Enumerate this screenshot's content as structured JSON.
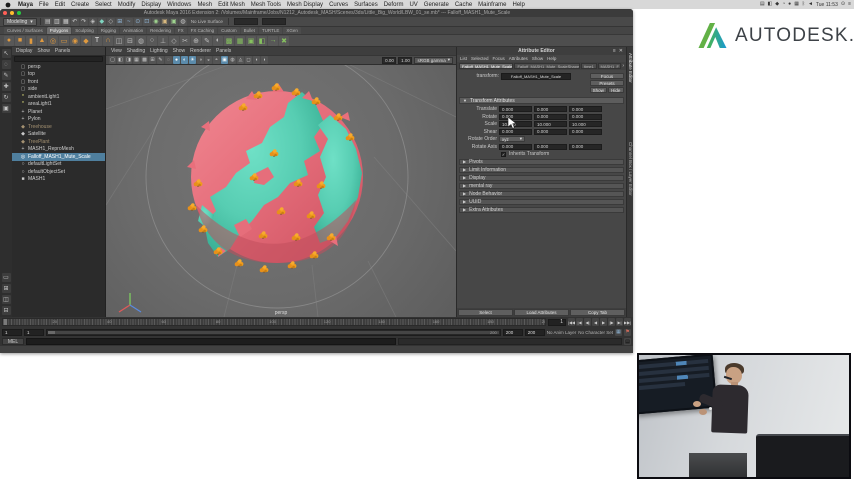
{
  "menubar": {
    "items": [
      "Maya",
      "File",
      "Edit",
      "Create",
      "Select",
      "Modify",
      "Display",
      "Windows",
      "Mesh",
      "Edit Mesh",
      "Mesh Tools",
      "Mesh Display",
      "Curves",
      "Surfaces",
      "Deform",
      "UV",
      "Generate",
      "Cache",
      "Mainframe",
      "Help"
    ],
    "status_icons": [
      {
        "name": "display-icon",
        "glyph": "▤"
      },
      {
        "name": "mirror-icon",
        "glyph": "◧"
      },
      {
        "name": "dropbox-icon",
        "glyph": "◆"
      },
      {
        "name": "time-machine-icon",
        "glyph": "◔"
      },
      {
        "name": "user-icon",
        "glyph": "●"
      },
      {
        "name": "cloud-icon",
        "glyph": "▦"
      },
      {
        "name": "bluetooth-icon",
        "glyph": "ᛒ"
      },
      {
        "name": "volume-icon",
        "glyph": "◄"
      }
    ],
    "clock": "Tue 11:53",
    "spotlight_glyph": "⊙",
    "notification_glyph": "≡"
  },
  "window": {
    "title": "Autodesk Maya 2016 Extension 2: /Volumes/Mainframe/Jobs/N1212_Autodesk_MASH/Scenes/3ds/Little_Big_World/LBW_01_se.mb* --- Falloff_MASH1_Mute_Scale"
  },
  "statusline": {
    "mode": "Modeling",
    "no_live_surface": "No Live Surface",
    "icons": [
      {
        "name": "new-scene-icon",
        "glyph": "▤",
        "color": "#c9c9c9"
      },
      {
        "name": "open-scene-icon",
        "glyph": "▥",
        "color": "#c9c9c9"
      },
      {
        "name": "save-scene-icon",
        "glyph": "▦",
        "color": "#c9c9c9"
      },
      {
        "name": "undo-icon",
        "glyph": "↶",
        "color": "#c9c9c9"
      },
      {
        "name": "redo-icon",
        "glyph": "↷",
        "color": "#c9c9c9"
      },
      {
        "name": "select-hierarchy-icon",
        "glyph": "◈",
        "color": "#bfbfbf"
      },
      {
        "name": "select-object-icon",
        "glyph": "◆",
        "color": "#7fd4c0"
      },
      {
        "name": "select-component-icon",
        "glyph": "◇",
        "color": "#bfbfbf"
      },
      {
        "name": "snap-grid-icon",
        "glyph": "⊞",
        "color": "#8fb6d8"
      },
      {
        "name": "snap-curve-icon",
        "glyph": "~",
        "color": "#8fb6d8"
      },
      {
        "name": "snap-point-icon",
        "glyph": "⊙",
        "color": "#8fb6d8"
      },
      {
        "name": "snap-plane-icon",
        "glyph": "⊡",
        "color": "#8fb6d8"
      },
      {
        "name": "make-live-icon",
        "glyph": "◉",
        "color": "#9fd48f"
      },
      {
        "name": "render-icon",
        "glyph": "▣",
        "color": "#d8b97f"
      },
      {
        "name": "ipr-render-icon",
        "glyph": "▣",
        "color": "#9fd48f"
      },
      {
        "name": "render-settings-icon",
        "glyph": "◍",
        "color": "#c9c9c9"
      }
    ]
  },
  "shelf": {
    "tabs": [
      {
        "label": "Curves / Surfaces"
      },
      {
        "label": "Polygons",
        "active": true
      },
      {
        "label": "Sculpting"
      },
      {
        "label": "Rigging"
      },
      {
        "label": "Animation"
      },
      {
        "label": "Rendering"
      },
      {
        "label": "FX"
      },
      {
        "label": "FX Caching"
      },
      {
        "label": "Custom"
      },
      {
        "label": "Bullet"
      },
      {
        "label": "TURTLE"
      },
      {
        "label": "XGen"
      }
    ],
    "icons": [
      {
        "name": "poly-sphere-icon",
        "glyph": "●",
        "color": "#e09a3f"
      },
      {
        "name": "poly-cube-icon",
        "glyph": "■",
        "color": "#e09a3f"
      },
      {
        "name": "poly-cylinder-icon",
        "glyph": "▮",
        "color": "#e09a3f"
      },
      {
        "name": "poly-cone-icon",
        "glyph": "▲",
        "color": "#e09a3f"
      },
      {
        "name": "poly-torus-icon",
        "glyph": "◎",
        "color": "#e09a3f"
      },
      {
        "name": "poly-plane-icon",
        "glyph": "▭",
        "color": "#e09a3f"
      },
      {
        "name": "poly-disc-icon",
        "glyph": "◉",
        "color": "#e09a3f"
      },
      {
        "name": "platonic-solid-icon",
        "glyph": "◆",
        "color": "#e09a3f"
      },
      {
        "name": "poly-text-icon",
        "glyph": "T",
        "color": "#e8e8e8"
      },
      {
        "name": "sweep-mesh-icon",
        "glyph": "∩",
        "color": "#e09a3f"
      },
      {
        "name": "combine-icon",
        "glyph": "◫",
        "color": "#bdbdbd"
      },
      {
        "name": "separate-icon",
        "glyph": "⊟",
        "color": "#bdbdbd"
      },
      {
        "name": "boolean-icon",
        "glyph": "◍",
        "color": "#bdbdbd"
      },
      {
        "name": "smooth-icon",
        "glyph": "○",
        "color": "#bdbdbd"
      },
      {
        "name": "extrude-icon",
        "glyph": "⊥",
        "color": "#bdbdbd"
      },
      {
        "name": "bevel-icon",
        "glyph": "◇",
        "color": "#bdbdbd"
      },
      {
        "name": "multi-cut-icon",
        "glyph": "✂",
        "color": "#bdbdbd"
      },
      {
        "name": "target-weld-icon",
        "glyph": "⊕",
        "color": "#bdbdbd"
      },
      {
        "name": "quad-draw-icon",
        "glyph": "✎",
        "color": "#bdbdbd"
      },
      {
        "name": "mirror-geo-icon",
        "glyph": "◐",
        "color": "#bdbdbd"
      },
      {
        "name": "mash-network-icon",
        "glyph": "▩",
        "color": "#86c15f"
      },
      {
        "name": "mash-distribute-icon",
        "glyph": "▦",
        "color": "#86c15f"
      },
      {
        "name": "mash-dynamics-icon",
        "glyph": "▣",
        "color": "#86c15f"
      },
      {
        "name": "mash-color-icon",
        "glyph": "◧",
        "color": "#86c15f"
      },
      {
        "name": "mash-curve-icon",
        "glyph": "→",
        "color": "#86c15f"
      },
      {
        "name": "mash-delete-icon",
        "glyph": "✖",
        "color": "#86c15f"
      }
    ]
  },
  "toolbox": {
    "tools": [
      {
        "name": "select-tool-icon",
        "glyph": "↖"
      },
      {
        "name": "lasso-tool-icon",
        "glyph": "◌"
      },
      {
        "name": "paint-select-tool-icon",
        "glyph": "✎"
      },
      {
        "name": "move-tool-icon",
        "glyph": "✚"
      },
      {
        "name": "rotate-tool-icon",
        "glyph": "↻"
      },
      {
        "name": "scale-tool-icon",
        "glyph": "▣"
      }
    ],
    "layouts": [
      {
        "name": "single-pane-layout-icon",
        "glyph": "▭"
      },
      {
        "name": "four-pane-layout-icon",
        "glyph": "⊞"
      },
      {
        "name": "persp-outliner-layout-icon",
        "glyph": "◫"
      },
      {
        "name": "hypershade-layout-icon",
        "glyph": "⊟"
      }
    ]
  },
  "outliner": {
    "menus": [
      "Display",
      "Show",
      "Panels"
    ],
    "items": [
      {
        "label": "persp",
        "glyph": "▢",
        "color": "#b9b9b9"
      },
      {
        "label": "top",
        "glyph": "▢",
        "color": "#b9b9b9"
      },
      {
        "label": "front",
        "glyph": "▢",
        "color": "#b9b9b9"
      },
      {
        "label": "side",
        "glyph": "▢",
        "color": "#b9b9b9"
      },
      {
        "label": "ambientLight1",
        "glyph": "*",
        "color": "#e8e87f"
      },
      {
        "label": "areaLight1",
        "glyph": "*",
        "color": "#e8e87f"
      },
      {
        "label": "Planet",
        "glyph": "+",
        "color": "#c9c9c9"
      },
      {
        "label": "Pylon",
        "glyph": "+",
        "color": "#c9c9c9"
      },
      {
        "label": "Treehouse",
        "glyph": "◆",
        "color": "#a59272",
        "dim": true
      },
      {
        "label": "Satellite",
        "glyph": "◆",
        "color": "#c9c9c9"
      },
      {
        "label": "TreePlant",
        "glyph": "◆",
        "color": "#a59272",
        "dim": true
      },
      {
        "label": "MASH1_ReproMesh",
        "glyph": "+",
        "color": "#c9c9c9"
      },
      {
        "label": "Falloff_MASH1_Mute_Scale",
        "glyph": "◎",
        "color": "#ffffff",
        "selected": true
      },
      {
        "label": "defaultLightSet",
        "glyph": "○",
        "color": "#c9c9c9"
      },
      {
        "label": "defaultObjectSet",
        "glyph": "○",
        "color": "#c9c9c9"
      },
      {
        "label": "MASH1",
        "glyph": "■",
        "color": "#c9c9c9"
      }
    ]
  },
  "viewport": {
    "menus": [
      "View",
      "Shading",
      "Lighting",
      "Show",
      "Renderer",
      "Panels"
    ],
    "icons": [
      {
        "name": "select-camera-icon",
        "glyph": "▢"
      },
      {
        "name": "lock-camera-icon",
        "glyph": "◧"
      },
      {
        "name": "camera-attributes-icon",
        "glyph": "◨"
      },
      {
        "name": "bookmark-icon",
        "glyph": "▦"
      },
      {
        "name": "image-plane-icon",
        "glyph": "▩"
      },
      {
        "name": "2d-pan-zoom-icon",
        "glyph": "⊞"
      },
      {
        "name": "grease-pencil-icon",
        "glyph": "✎"
      },
      {
        "name": "wireframe-icon",
        "glyph": "◌"
      },
      {
        "name": "shaded-icon",
        "glyph": "●",
        "active": true
      },
      {
        "name": "textured-icon",
        "glyph": "◐",
        "active": true
      },
      {
        "name": "use-all-lights-icon",
        "glyph": "☀",
        "active": true
      },
      {
        "name": "shadows-icon",
        "glyph": "◑"
      },
      {
        "name": "screen-space-ao-icon",
        "glyph": "◒"
      },
      {
        "name": "motion-blur-icon",
        "glyph": "◓"
      },
      {
        "name": "multisample-icon",
        "glyph": "▣",
        "active": true
      },
      {
        "name": "depth-of-field-icon",
        "glyph": "◍"
      },
      {
        "name": "isolate-select-icon",
        "glyph": "◬"
      },
      {
        "name": "xray-icon",
        "glyph": "◻"
      },
      {
        "name": "exposure-icon",
        "glyph": "◖"
      },
      {
        "name": "gamma-icon",
        "glyph": "◗"
      }
    ],
    "exposure": "0.00",
    "gamma": "1.00",
    "view_transform": "sRGB gamma",
    "camera_label": "persp"
  },
  "ae": {
    "title": "Attribute Editor",
    "pin_glyph": "≡",
    "close_glyph": "✕",
    "menus": [
      "List",
      "Selected",
      "Focus",
      "Attributes",
      "Show",
      "Help"
    ],
    "tabs": [
      {
        "label": "Falloff_MASH1_Mute_Scale",
        "active": true
      },
      {
        "label": "Falloff_MASH1_Mute_ScaleShape"
      },
      {
        "label": "time1"
      },
      {
        "label": "MASH1_F"
      }
    ],
    "transform_label": "transform:",
    "transform_value": "Falloff_MASH1_Mute_Scale",
    "focus_label": "Focus",
    "presets_label": "Presets",
    "show_label": "Show",
    "hide_label": "Hide",
    "section_transform": "Transform Attributes",
    "rows": [
      {
        "label": "Translate",
        "values": [
          "0.000",
          "0.000",
          "0.000"
        ]
      },
      {
        "label": "Rotate",
        "values": [
          "0.000",
          "0.000",
          "0.000"
        ]
      },
      {
        "label": "Scale",
        "values": [
          "10.000",
          "10.000",
          "10.000"
        ]
      },
      {
        "label": "Shear",
        "values": [
          "0.000",
          "0.000",
          "0.000"
        ]
      }
    ],
    "rotate_order_label": "Rotate Order",
    "rotate_order_value": "xyz",
    "rotate_axis_label": "Rotate Axis",
    "rotate_axis_values": [
      "0.000",
      "0.000",
      "0.000"
    ],
    "inherits_label": "Inherits Transform",
    "sections": [
      "Pivots",
      "Limit Information",
      "Display",
      "mental ray",
      "Node Behavior",
      "UUID",
      "Extra Attributes"
    ],
    "footer": [
      "Select",
      "Load Attributes",
      "Copy Tab"
    ],
    "side_tabs": [
      "Attribute Editor",
      "Channel Box / Layer Editor"
    ]
  },
  "timeline": {
    "current": "1",
    "start": 1,
    "end": 200,
    "number_step": 20,
    "playback_glyphs": [
      "|◀◀",
      "|◀",
      "◀|",
      "◀",
      "▶",
      "|▶",
      "▶|",
      "▶▶|"
    ]
  },
  "range": {
    "start": "1",
    "playback_start": "1",
    "playback_end": "200",
    "end": "200",
    "bar_label": "200",
    "anim_layer": "No Anim Layer",
    "character_set": "No Character Set",
    "muted_icon_glyph": "▦",
    "key_icon_glyph": "⚑"
  },
  "command_line": {
    "label": "MEL"
  },
  "brand": {
    "wordmark": "AUTODESK."
  }
}
